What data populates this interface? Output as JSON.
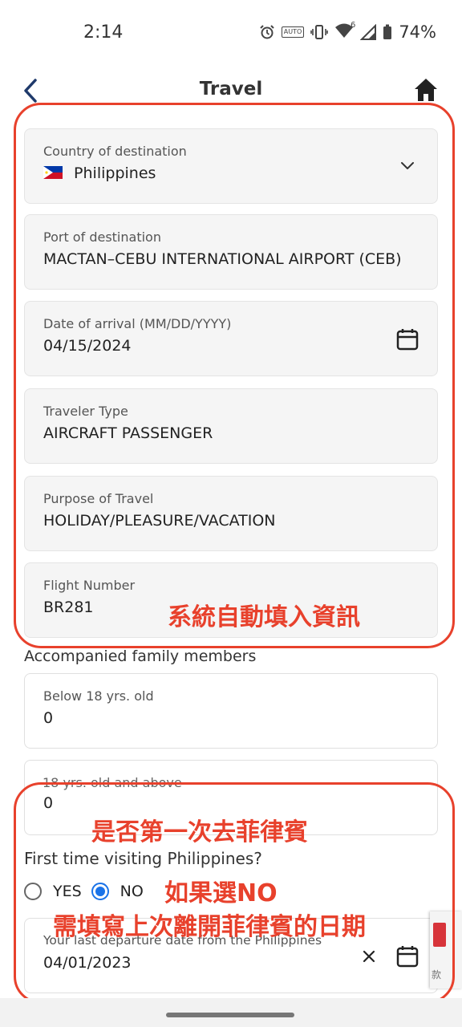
{
  "status_bar": {
    "time": "2:14",
    "auto_icon": "AUTO",
    "signal_badge": "6",
    "battery": "74%"
  },
  "header": {
    "title": "Travel",
    "back_icon": "chevron-left-icon",
    "home_icon": "home-icon"
  },
  "fields": {
    "country": {
      "label": "Country of destination",
      "value": "Philippines",
      "flag": "philippines-flag-icon"
    },
    "port": {
      "label": "Port of destination",
      "value": "MACTAN–CEBU INTERNATIONAL AIRPORT (CEB)"
    },
    "arrival": {
      "label": "Date of arrival (MM/DD/YYYY)",
      "value": "04/15/2024"
    },
    "traveler_type": {
      "label": "Traveler Type",
      "value": "AIRCRAFT PASSENGER"
    },
    "purpose": {
      "label": "Purpose of Travel",
      "value": "HOLIDAY/PLEASURE/VACATION"
    },
    "flight": {
      "label": "Flight Number",
      "value": "BR281"
    },
    "below18": {
      "label": "Below 18 yrs. old",
      "value": "0"
    },
    "above18": {
      "label": "18 yrs. old and above",
      "value": "0"
    },
    "last_departure": {
      "label": "Your last departure date from the Philippines",
      "value": "04/01/2023"
    }
  },
  "accompanied_label": "Accompanied family members",
  "first_time": {
    "question": "First time visiting Philippines?",
    "options": [
      "YES",
      "NO"
    ],
    "selected": "NO"
  },
  "annotations": {
    "auto_fill": "系統自動填入資訊",
    "first_time_q": "是否第一次去菲律賓",
    "if_no": "如果選NO",
    "need_date": "需填寫上次離開菲律賓的日期"
  },
  "recaptcha_text": "款",
  "colors": {
    "annotation_red": "#e8412c",
    "radio_blue": "#1a73e8",
    "field_bg": "#f5f5f5"
  }
}
